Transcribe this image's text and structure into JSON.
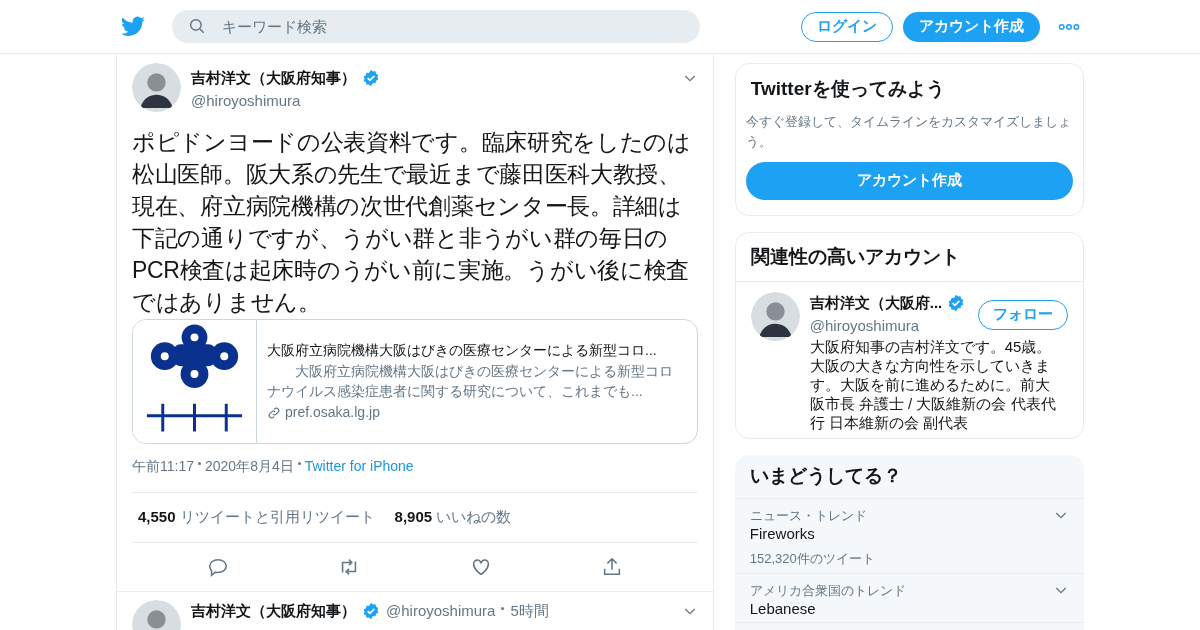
{
  "header": {
    "search": {
      "placeholder": "キーワード検索"
    },
    "login": "ログイン",
    "signup": "アカウント作成"
  },
  "tweet": {
    "name": "吉村洋文（大阪府知事）",
    "verified": true,
    "handle": "@hiroyoshimura",
    "text": "ポピドンヨードの公表資料です。臨床研究をしたのは松山医師。阪大系の先生で最近まで藤田医科大教授、現在、府立病院機構の次世代創薬センター長。詳細は下記の通りですが、うがい群と非うがい群の毎日のPCR検査は起床時のうがい前に実施。うがい後に検査ではありません。",
    "card": {
      "title": "大阪府立病院機構大阪はびきの医療センターによる新型コロ...",
      "description": "　　大阪府立病院機構大阪はびきの医療センターによる新型コロナウイルス感染症患者に関する研究について、これまでも...",
      "domain": "pref.osaka.lg.jp"
    },
    "time": "午前11:17",
    "date": "2020年8月4日",
    "source": "Twitter for iPhone",
    "stats": [
      {
        "count": "4,550",
        "label": "リツイートと引用リツイート"
      },
      {
        "count": "8,905",
        "label": "いいねの数"
      }
    ]
  },
  "next_tweet": {
    "name": "吉村洋文（大阪府知事）",
    "verified": true,
    "handle": "@hiroyoshimura",
    "age": "5時間"
  },
  "signup_card": {
    "title": "Twitterを使ってみよう",
    "text": "今すぐ登録して、タイムラインをカスタマイズしましょう。",
    "button": "アカウント作成"
  },
  "related": {
    "title": "関連性の高いアカウント",
    "accounts": [
      {
        "name": "吉村洋文（大阪府...",
        "verified": true,
        "handle": "@hiroyoshimura",
        "follow": "フォロー",
        "bio": "大阪府知事の吉村洋文です。45歳。大阪の大きな方向性を示していきます。大阪を前に進めるために。前大阪市長 弁護士 / 大阪維新の会 代表代行 日本維新の会 副代表"
      }
    ]
  },
  "trends": {
    "title": "いまどうしてる？",
    "items": [
      {
        "context": "ニュース・トレンド",
        "name": "Fireworks",
        "count": "152,320件のツイート"
      },
      {
        "context": "アメリカ合衆国のトレンド",
        "name": "Lebanese"
      }
    ]
  }
}
